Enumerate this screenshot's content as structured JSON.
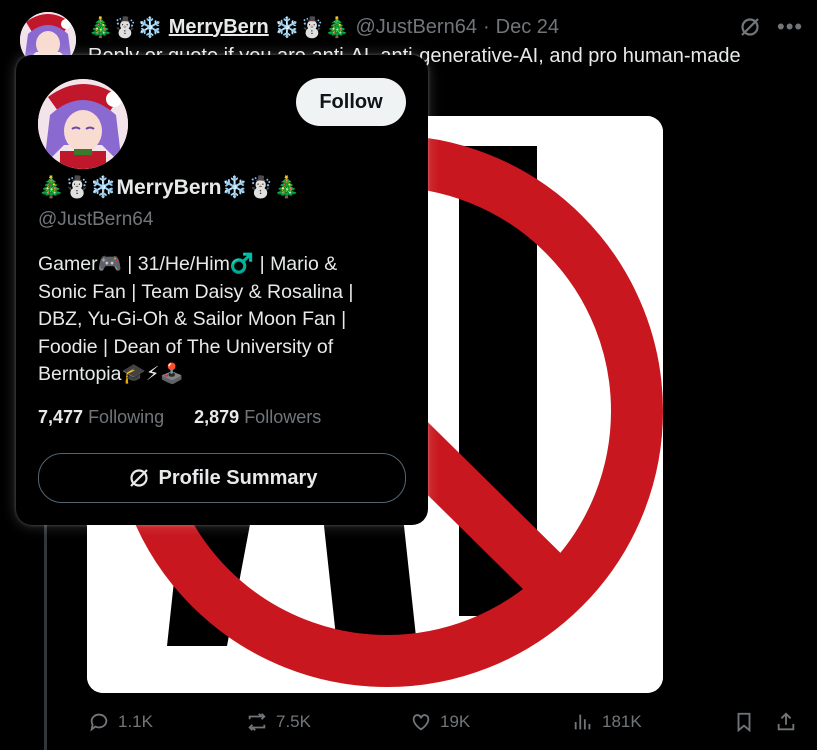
{
  "tweet": {
    "display_name": "MerryBern",
    "name_emoji_left": "🎄☃️❄️",
    "name_emoji_right": "❄️☃️🎄",
    "handle": "@JustBern64",
    "separator": "·",
    "date": "Dec 24",
    "text": "Reply or quote if you are anti-AI, anti-generative-AI, and pro human-made",
    "media_text": "AI",
    "stats": {
      "replies": "1.1K",
      "reposts": "7.5K",
      "likes": "19K",
      "views": "181K"
    }
  },
  "hover_card": {
    "follow_label": "Follow",
    "display_name": "MerryBern",
    "name_emoji_left": "🎄☃️❄️",
    "name_emoji_right": "❄️☃️🎄",
    "handle": "@JustBern64",
    "bio_lines": [
      "Gamer🎮 | 31/He/Him♂️ | Mario &",
      "Sonic Fan | Team Daisy & Rosalina |",
      "DBZ, Yu-Gi-Oh & Sailor Moon Fan |",
      "Foodie | Dean of The University of",
      "Berntopia🎓⚡🕹️"
    ],
    "following_count": "7,477",
    "following_label": "Following",
    "followers_count": "2,879",
    "followers_label": "Followers",
    "summary_label": "Profile Summary"
  },
  "colors": {
    "background": "#000000",
    "text_primary": "#e7e9ea",
    "text_secondary": "#71767b",
    "follow_button": "#eff3f4",
    "no_symbol_red": "#c8171e"
  },
  "icons": [
    "grok-icon",
    "more-icon",
    "reply-icon",
    "repost-icon",
    "like-icon",
    "views-icon",
    "bookmark-icon",
    "share-icon"
  ]
}
